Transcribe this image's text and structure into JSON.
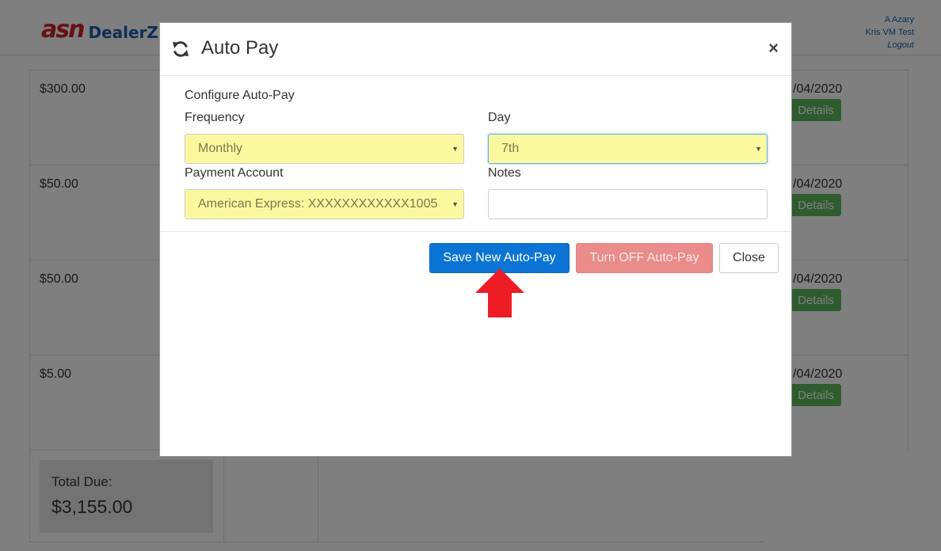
{
  "header": {
    "logo_asn": "asn",
    "logo_dealer": "DealerZ",
    "user_name": "A Azary",
    "company": "Kris VM Test",
    "logout": "Logout"
  },
  "background_rows": [
    {
      "amount": "$300.00",
      "date": "/04/2020",
      "action": "Details"
    },
    {
      "amount": "$50.00",
      "date": "/04/2020",
      "action": "Details"
    },
    {
      "amount": "$50.00",
      "date": "/04/2020",
      "action": "Details"
    },
    {
      "amount": "$5.00",
      "date": "/04/2020",
      "action": "Details"
    }
  ],
  "summary": {
    "total_label": "Total Due:",
    "total_value": "$3,155.00"
  },
  "modal": {
    "title": "Auto Pay",
    "close_symbol": "×",
    "section_label": "Configure Auto-Pay",
    "frequency": {
      "label": "Frequency",
      "value": "Monthly"
    },
    "day": {
      "label": "Day",
      "value": "7th"
    },
    "payment_account": {
      "label": "Payment Account",
      "value": "American Express: XXXXXXXXXXXX1005"
    },
    "notes": {
      "label": "Notes",
      "value": ""
    },
    "buttons": {
      "save": "Save New Auto-Pay",
      "turn_off": "Turn OFF Auto-Pay",
      "close": "Close"
    }
  },
  "colors": {
    "primary": "#0b74d4",
    "danger_disabled": "#ea8c8a",
    "success": "#5cb85c",
    "autofill_yellow": "#fbf9a0",
    "arrow": "#ee1c24"
  },
  "icons": {
    "header_icon": "refresh-icon",
    "annotation": "red-arrow-up-icon",
    "select_caret": "caret-down-icon"
  }
}
